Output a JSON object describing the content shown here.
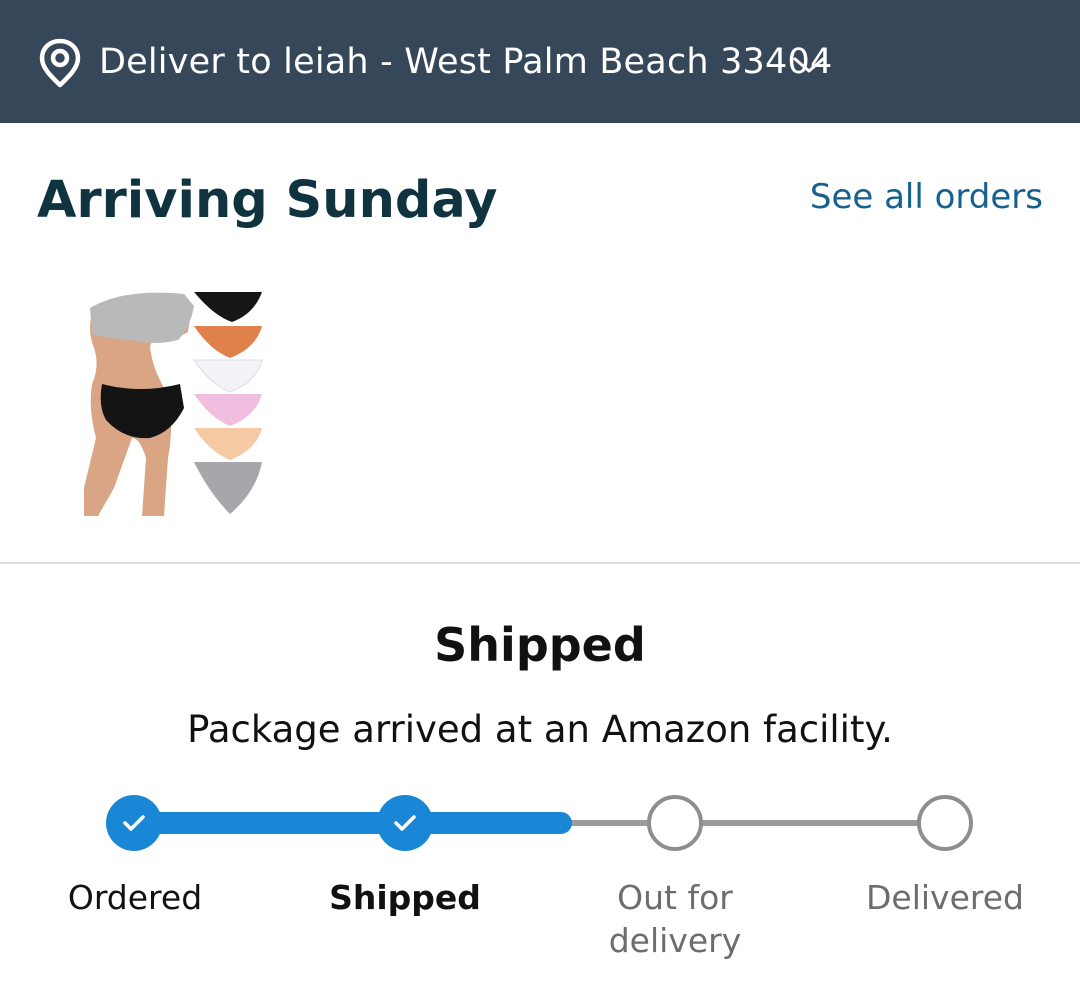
{
  "header": {
    "deliver_to": "Deliver to leiah - West Palm Beach 33404",
    "location_icon": "location-pin-icon",
    "dropdown_icon": "chevron-down-icon",
    "background_color": "#37475a"
  },
  "order": {
    "arrival_heading": "Arriving Sunday",
    "see_all_link": "See all orders",
    "product_image": "underwear-multipack-product-image"
  },
  "status": {
    "title": "Shipped",
    "subtitle": "Package arrived at an Amazon facility.",
    "accent_color": "#1a86d6",
    "progress_fraction": 0.6,
    "steps": [
      {
        "label": "Ordered",
        "state": "done"
      },
      {
        "label": "Shipped",
        "state": "current"
      },
      {
        "label": "Out for delivery",
        "state": "pending"
      },
      {
        "label": "Delivered",
        "state": "pending"
      }
    ]
  }
}
